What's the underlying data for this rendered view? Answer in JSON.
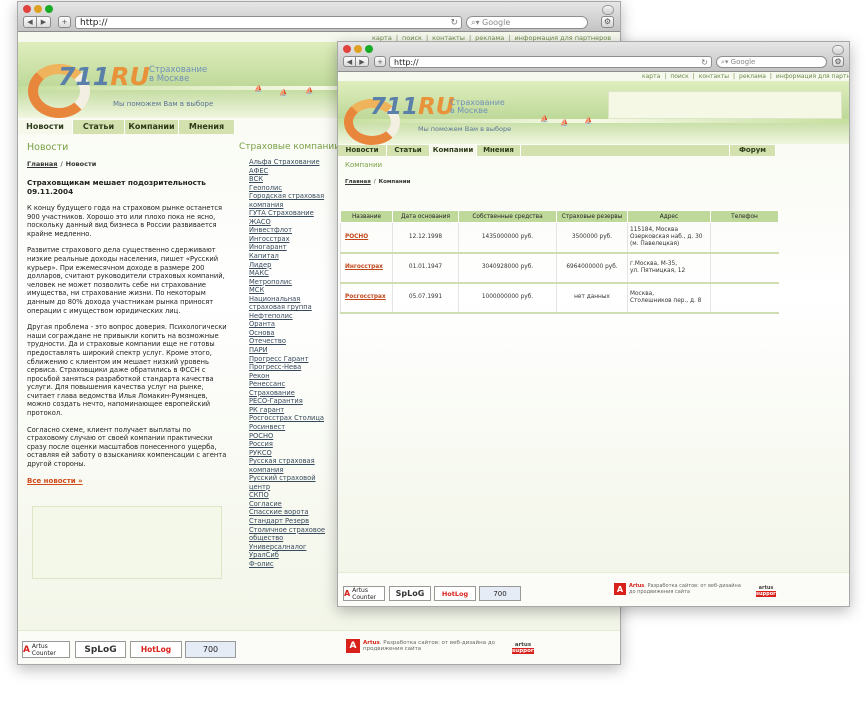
{
  "browser": {
    "url": "http://",
    "search_placeholder": "Google"
  },
  "site": {
    "logo": "711",
    "logo_suffix": "RU",
    "tagline_line1": "Страхование",
    "tagline_line2": "в Москве",
    "motto": "Мы поможем Вам в выборе",
    "topnav": [
      "карта",
      "поиск",
      "контакты",
      "реклама",
      "информация для партнеров"
    ],
    "topnav_sep": "|"
  },
  "back": {
    "menu": [
      "Новости",
      "Статьи",
      "Компании",
      "Мнения"
    ],
    "section_title": "Новости",
    "breadcrumb": {
      "home": "Главная",
      "sep": "/",
      "current": "Новости"
    },
    "article": {
      "title": "Страховщикам мешает подозрительность 09.11.2004",
      "paragraphs": [
        "К концу будущего года на страховом рынке останется 900 участников. Хорошо это или плохо пока не ясно, поскольку данный вид бизнеса в России развивается крайне медленно.",
        "Развитие страхового дела существенно сдерживают низкие реальные доходы населения, пишет «Русский курьер». При ежемесячном доходе в размере 200 долларов, считают руководители страховых компаний, человек не может позволить себе ни страхование имущества, ни страхование жизни. По некоторым данным до 80% дохода участникам рынка приносят операции с имуществом юридических лиц.",
        "Другая проблема - это вопрос доверия. Психологически наши сограждане не привыкли копить на возможные трудности. Да и страховые компании еще не готовы предоставлять широкий спектр услуг. Кроме этого, сближению с клиентом им мешает низкий уровень сервиса. Страховщики даже обратились в ФССН с просьбой заняться разработкой стандарта качества услуги. Для повышения качества услуг на рынке, считает глава ведомства Илья Ломакин-Румянцев, можно создать нечто, напоминающее европейский протокол.",
        "Согласно схеме, клиент получает выплаты по страховому случаю от своей компании практически сразу после оценки масштабов понесенного ущерба, оставляя ей заботу о взысканиях компенсации с агента другой стороны."
      ],
      "all_news": "Все новости »"
    },
    "companies_title": "Страховые компании",
    "companies": [
      "Альфа Страхование",
      "АФЕС",
      "ВСК",
      "Геополис",
      "Городская страховая компания",
      "ГУТА Страхование",
      "ЖАСО",
      "Инвестфлот",
      "Ингосстрах",
      "Иногарант",
      "Капитал",
      "Лидер",
      "МАКС",
      "Метрополис",
      "МСК",
      "Национальная страховая группа",
      "Нефтеполис",
      "Оранта",
      "Основа",
      "Отечество",
      "ПАРИ",
      "Прогресс Гарант",
      "Прогресс-Нева",
      "Рекон",
      "Ренессанс",
      "Страхование",
      "РЕСО-Гарантия",
      "РК гарант",
      "Росгосстрах Столица",
      "Росинвест",
      "РОСНО",
      "Россия",
      "РУКСО",
      "Русская страховая компания",
      "Русский страховой центр",
      "СКПО",
      "Согласие",
      "Спасские ворота",
      "Стандарт Резерв",
      "Столичное страховое общество",
      "Универсалналог",
      "УралСиб",
      "Ф-олис"
    ]
  },
  "front": {
    "menu": [
      "Новости",
      "Статьи",
      "Компании",
      "Мнения"
    ],
    "forum": "Форум",
    "section_title": "Компании",
    "breadcrumb": {
      "home": "Главная",
      "sep": "/",
      "current": "Компании"
    },
    "table": {
      "headers": [
        "Название",
        "Дата основания",
        "Собственные средства",
        "Страховые резервы",
        "Адрес",
        "Телефон"
      ],
      "rows": [
        {
          "name": "РОСНО",
          "date": "12.12.1998",
          "own": "1435000000 руб.",
          "reserve": "3500000 руб.",
          "addr": [
            "115184, Москва",
            "Озерковская наб., д. 30",
            "(м. Павелецкая)"
          ],
          "phone": ""
        },
        {
          "name": "Ингосстрах",
          "date": "01.01.1947",
          "own": "3040928000 руб.",
          "reserve": "6964000000 руб.",
          "addr": [
            "г.Москва, М-35,",
            "ул. Пятницкая, 12"
          ],
          "phone": ""
        },
        {
          "name": "Росгосстрах",
          "date": "05.07.1991",
          "own": "1000000000 руб.",
          "reserve": "нет данных",
          "addr": [
            "Москва,",
            "Столешников пер., д. 8"
          ],
          "phone": ""
        }
      ]
    }
  },
  "footer": {
    "badges": [
      "Artus Counter",
      "SpLoG",
      "HotLog",
      "700"
    ],
    "artus_name": "Artus",
    "artus_text": ". Разработка сайтов: от веб-дизайна до продвижения сайта",
    "support_top": "artus",
    "support_bottom": "support"
  },
  "colors": {
    "menu": "#d2e1ad",
    "accent": "#79a044",
    "link": "#c2461a",
    "table_header": "#bfd99b"
  }
}
